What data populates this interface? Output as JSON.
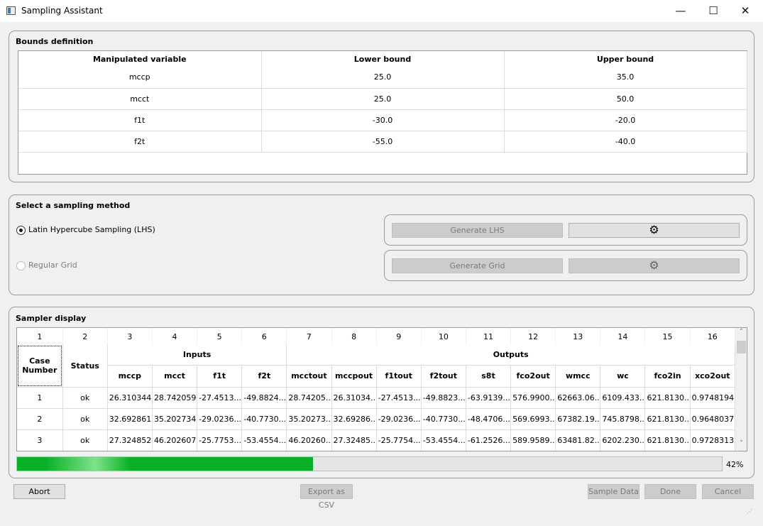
{
  "window": {
    "title": "Sampling Assistant",
    "minimize": "—",
    "maximize": "☐",
    "close": "✕"
  },
  "bounds": {
    "title": "Bounds definition",
    "headers": [
      "Manipulated variable",
      "Lower bound",
      "Upper bound"
    ],
    "rows": [
      [
        "mccp",
        "25.0",
        "35.0"
      ],
      [
        "mcct",
        "25.0",
        "50.0"
      ],
      [
        "f1t",
        "-30.0",
        "-20.0"
      ],
      [
        "f2t",
        "-55.0",
        "-40.0"
      ]
    ]
  },
  "method": {
    "title": "Select a sampling method",
    "lhs": {
      "label": "Latin Hypercube Sampling (LHS)",
      "selected": true,
      "generate": "Generate LHS",
      "settings_icon": "gear-icon"
    },
    "grid": {
      "label": "Regular Grid",
      "selected": false,
      "generate": "Generate Grid",
      "settings_icon": "gear-icon"
    }
  },
  "sampler": {
    "title": "Sampler display",
    "column_numbers": [
      "1",
      "2",
      "3",
      "4",
      "5",
      "6",
      "7",
      "8",
      "9",
      "10",
      "11",
      "12",
      "13",
      "14",
      "15",
      "16"
    ],
    "case_header": "Case Number",
    "status_header": "Status",
    "inputs_header": "Inputs",
    "outputs_header": "Outputs",
    "variables": [
      "mccp",
      "mcct",
      "f1t",
      "f2t",
      "mcctout",
      "mccpout",
      "f1tout",
      "f2tout",
      "s8t",
      "fco2out",
      "wmcc",
      "wc",
      "fco2in",
      "xco2out"
    ],
    "rows": [
      [
        "1",
        "ok",
        "26.3103445",
        "28.7420594",
        "-27.4513...",
        "-49.8824...",
        "28.74205...",
        "26.31034...",
        "-27.4513...",
        "-49.8823...",
        "-63.9139...",
        "576.9900...",
        "62663.06...",
        "6109.433...",
        "621.8130...",
        "0.9748194"
      ],
      [
        "2",
        "ok",
        "32.6928613",
        "35.2027340",
        "-29.0236...",
        "-40.7730...",
        "35.20273...",
        "32.69286...",
        "-29.0236...",
        "-40.7730...",
        "-48.4706...",
        "569.6993...",
        "67382.19...",
        "745.8798...",
        "621.8130...",
        "0.9648037"
      ],
      [
        "3",
        "ok",
        "27.3248526",
        "46.2026072",
        "-25.7753...",
        "-53.4554...",
        "46.20260...",
        "27.32485...",
        "-25.7754...",
        "-53.4554...",
        "-61.2526...",
        "589.9589...",
        "63481.82...",
        "6202.230...",
        "621.8130...",
        "0.9728313"
      ]
    ],
    "progress_percent": 42,
    "progress_label": "42%"
  },
  "buttons": {
    "abort": "Abort",
    "export": "Export as CSV",
    "sample": "Sample Data",
    "done": "Done",
    "cancel": "Cancel"
  },
  "colors": {
    "progress": "#06b025"
  }
}
